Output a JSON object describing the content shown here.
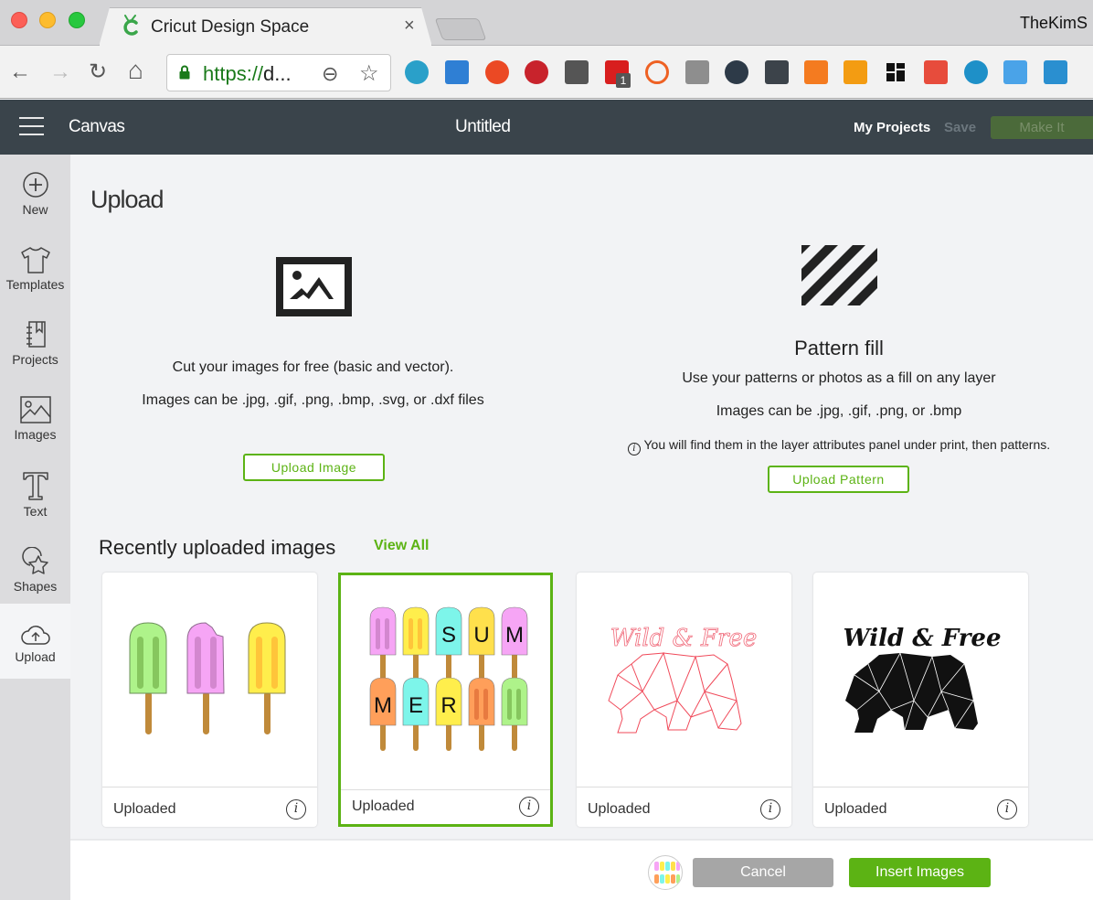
{
  "browser": {
    "tab_title": "Cricut Design Space",
    "tab_close": "×",
    "profile_name": "TheKimS",
    "url_scheme": "https://",
    "url_rest": "d...",
    "back_glyph": "←",
    "forward_glyph": "→",
    "reload_glyph": "↻",
    "home_glyph": "⌂",
    "zoom_glyph": "⊖",
    "star_glyph": "☆",
    "extensions": [
      {
        "name": "simplenote-icon",
        "color": "#2aa0c9"
      },
      {
        "name": "window-resizer-icon",
        "color": "#2f7fd4"
      },
      {
        "name": "stumbleupon-icon",
        "color": "#eb4924"
      },
      {
        "name": "pinterest-icon",
        "color": "#c8232c"
      },
      {
        "name": "mailtrack-icon",
        "color": "#555555"
      },
      {
        "name": "adblock-icon",
        "color": "#d81e1e",
        "badge": "1"
      },
      {
        "name": "bitly-icon",
        "color": "#ee6123"
      },
      {
        "name": "layers-icon",
        "color": "#8e8e8e"
      },
      {
        "name": "klout-icon",
        "color": "#2d3a48"
      },
      {
        "name": "lastpass-icon",
        "color": "#3c434a"
      },
      {
        "name": "analytics-icon",
        "color": "#f47b20"
      },
      {
        "name": "paint-drip-icon",
        "color": "#f39c12"
      },
      {
        "name": "grid-icon",
        "color": "#111111"
      },
      {
        "name": "flame-icon",
        "color": "#e74c3c"
      },
      {
        "name": "eye-icon",
        "color": "#1e90c8"
      },
      {
        "name": "fist-icon",
        "color": "#4aa3e8"
      },
      {
        "name": "wave-icon",
        "color": "#2a8fd0"
      }
    ]
  },
  "header": {
    "section": "Canvas",
    "title": "Untitled",
    "my_projects": "My Projects",
    "save": "Save",
    "make_it": "Make It"
  },
  "sidebar": {
    "items": [
      {
        "label": "New",
        "icon": "plus-circle-icon"
      },
      {
        "label": "Templates",
        "icon": "tshirt-icon"
      },
      {
        "label": "Projects",
        "icon": "notebook-icon"
      },
      {
        "label": "Images",
        "icon": "image-icon"
      },
      {
        "label": "Text",
        "icon": "text-icon"
      },
      {
        "label": "Shapes",
        "icon": "shapes-icon"
      },
      {
        "label": "Upload",
        "icon": "cloud-upload-icon",
        "active": true
      }
    ]
  },
  "main": {
    "title": "Upload",
    "image_upload": {
      "line1": "Cut your images for free (basic and vector).",
      "line2": "Images can be .jpg, .gif, .png, .bmp, .svg, or .dxf files",
      "button": "Upload Image"
    },
    "pattern_upload": {
      "heading": "Pattern fill",
      "line1": "Use your patterns or photos as a fill on any layer",
      "line2": "Images can be .jpg, .gif, .png, or .bmp",
      "note_glyph": "i",
      "note": "You will find them in the layer attributes panel under print, then patterns.",
      "button": "Upload Pattern"
    },
    "recent": {
      "title": "Recently uploaded images",
      "view_all": "View All",
      "cards": [
        {
          "label": "Uploaded",
          "thumbnail": "three popsicles",
          "selected": false
        },
        {
          "label": "Uploaded",
          "thumbnail": "SUMMER popsicles",
          "selected": true,
          "letters": [
            "S",
            "U",
            "M",
            "M",
            "E",
            "R"
          ]
        },
        {
          "label": "Uploaded",
          "thumbnail": "Wild & Free red outline bear",
          "selected": false,
          "caption": "Wild & Free"
        },
        {
          "label": "Uploaded",
          "thumbnail": "Wild & Free black bear",
          "selected": false,
          "caption": "Wild & Free"
        }
      ],
      "info_glyph": "i"
    }
  },
  "footer": {
    "cancel": "Cancel",
    "insert": "Insert Images"
  },
  "colors": {
    "accent": "#5cb314",
    "header_bg": "#3a444b",
    "sidebar_bg": "#dcdcde"
  }
}
